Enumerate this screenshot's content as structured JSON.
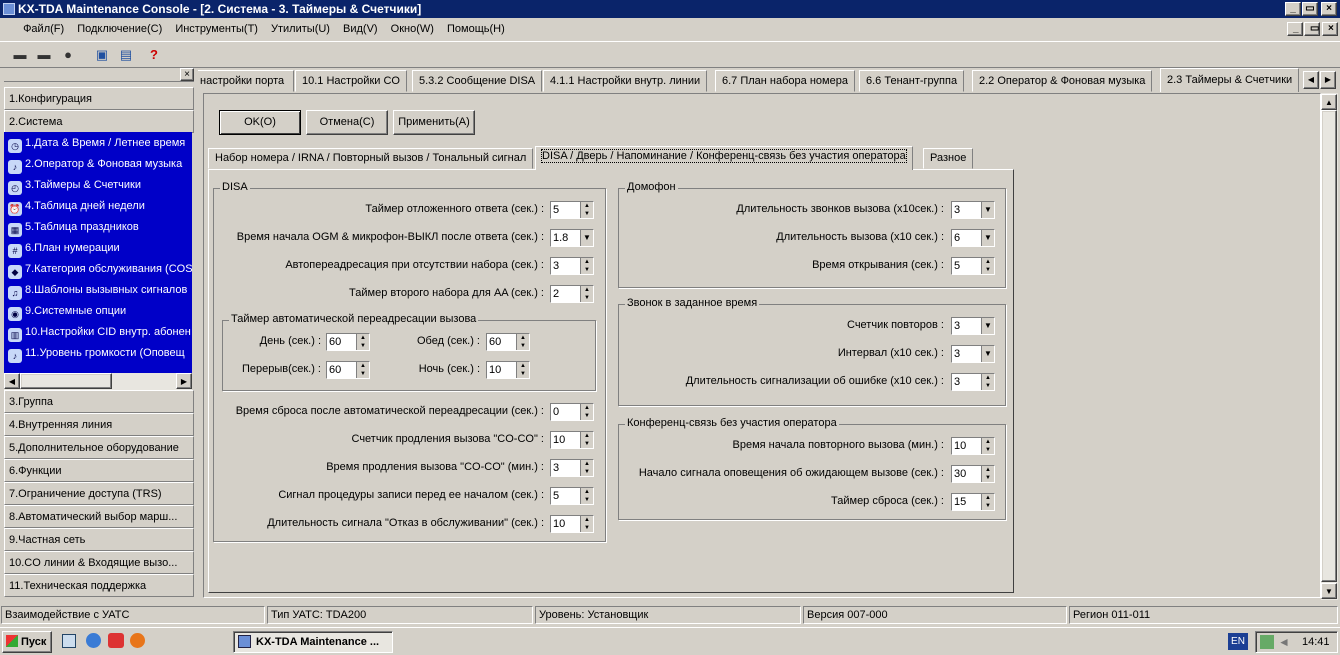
{
  "window": {
    "title": "KX-TDA Maintenance Console - [2. Система - 3. Таймеры & Счетчики]"
  },
  "menu": [
    "Файл(F)",
    "Подключение(C)",
    "Инструменты(T)",
    "Утилиты(U)",
    "Вид(V)",
    "Окно(W)",
    "Помощь(H)"
  ],
  "toolbar": {
    "icons": [
      "connect-icon",
      "disconnect-icon",
      "upload-icon",
      "download-icon",
      "report-icon",
      "help-icon"
    ]
  },
  "nav": {
    "groups_top": [
      "1.Конфигурация",
      "2.Система"
    ],
    "sub_items": [
      "1.Дата & Время / Летнее время",
      "2.Оператор & Фоновая музыка",
      "3.Таймеры & Счетчики",
      "4.Таблица дней недели",
      "5.Таблица праздников",
      "6.План нумерации",
      "7.Категория обслуживания (COS",
      "8.Шаблоны вызывных сигналов",
      "9.Системные опции",
      "10.Настройки CID внутр. абонен",
      "11.Уровень громкости (Оповещ"
    ],
    "groups_bottom": [
      "3.Группа",
      "4.Внутренняя линия",
      "5.Дополнительное оборудование",
      "6.Функции",
      "7.Ограничение доступа (TRS)",
      "8.Автоматический выбор марш...",
      "9.Частная сеть",
      "10.CO линии & Входящие вызо...",
      "11.Техническая поддержка"
    ]
  },
  "doc_tabs": [
    "настройки порта",
    "10.1 Настройки CO",
    "5.3.2 Сообщение DISA",
    "4.1.1 Настройки внутр. линии",
    "6.7 План набора номера",
    "6.6 Тенант-группа",
    "2.2 Оператор & Фоновая музыка",
    "2.3 Таймеры & Счетчики"
  ],
  "buttons": {
    "ok": "OK(O)",
    "cancel": "Отмена(C)",
    "apply": "Применить(A)"
  },
  "inner_tabs": [
    "Набор номера / IRNA / Повторный вызов / Тональный сигнал",
    "DISA / Дверь / Напоминание / Конференц-связь без участия оператора",
    "Разное"
  ],
  "disa": {
    "title": "DISA",
    "rows": [
      {
        "label": "Таймер отложенного ответа (сек.) :",
        "value": "5"
      },
      {
        "label": "Время начала OGM & микрофон-ВЫКЛ после ответа (сек.) :",
        "value": "1.8"
      },
      {
        "label": "Автопереадресация при отсутствии набора (сек.) :",
        "value": "3"
      },
      {
        "label": "Таймер второго набора для AA (сек.) :",
        "value": "2"
      }
    ],
    "auto_fwd": {
      "title": "Таймер автоматической переадресации вызова",
      "day_label": "День (сек.) :",
      "day": "60",
      "lunch_label": "Обед (сек.) :",
      "lunch": "60",
      "break_label": "Перерыв(сек.) :",
      "break": "60",
      "night_label": "Ночь (сек.) :",
      "night": "10"
    },
    "rows2": [
      {
        "label": "Время сброса после автоматической переадресации (сек.) :",
        "value": "0"
      },
      {
        "label": "Счетчик продления вызова \"CO-CO\" :",
        "value": "10"
      },
      {
        "label": "Время продления вызова \"CO-CO\" (мин.) :",
        "value": "3"
      },
      {
        "label": "Сигнал процедуры записи перед ее началом (сек.) :",
        "value": "5"
      },
      {
        "label": "Длительность сигнала \"Отказ в обслуживании\" (сек.) :",
        "value": "10"
      }
    ]
  },
  "doorphone": {
    "title": "Домофон",
    "rows": [
      {
        "label": "Длительность звонков вызова (x10сек.) :",
        "value": "3"
      },
      {
        "label": "Длительность вызова (x10 сек.) :",
        "value": "6"
      },
      {
        "label": "Время открывания (сек.) :",
        "value": "5"
      }
    ]
  },
  "timed_reminder": {
    "title": "Звонок в заданное время",
    "rows": [
      {
        "label": "Счетчик повторов :",
        "value": "3"
      },
      {
        "label": "Интервал (x10 сек.) :",
        "value": "3"
      },
      {
        "label": "Длительность сигнализации об ошибке (x10 сек.) :",
        "value": "3"
      }
    ]
  },
  "unattended_conf": {
    "title": "Конференц-связь без участия оператора",
    "rows": [
      {
        "label": "Время начала повторного вызова (мин.) :",
        "value": "10"
      },
      {
        "label": "Начало сигнала оповещения об ожидающем вызове (сек.) :",
        "value": "30"
      },
      {
        "label": "Таймер сброса (сек.) :",
        "value": "15"
      }
    ]
  },
  "status": [
    "Взаимодействие с УАТС",
    "Тип УАТС: TDA200",
    "Уровень: Установщик",
    "Версия 007-000",
    "Регион 011-011"
  ],
  "taskbar": {
    "start": "Пуск",
    "task": "KX-TDA Maintenance ...",
    "lang": "EN",
    "time": "14:41"
  }
}
